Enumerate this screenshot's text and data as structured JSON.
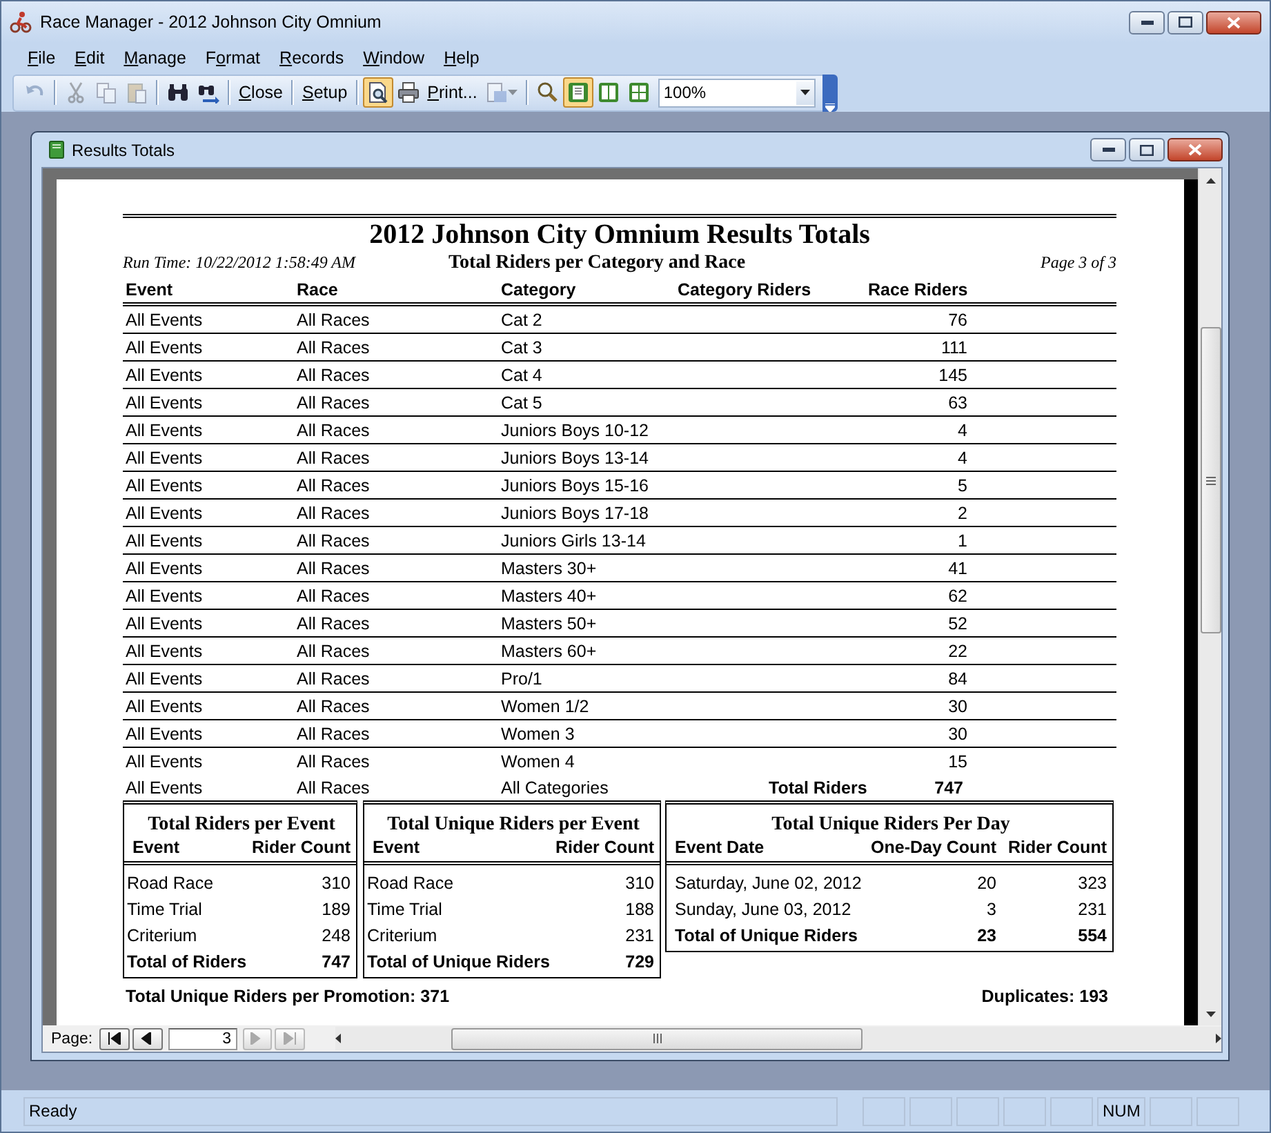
{
  "window": {
    "title": "Race Manager - 2012 Johnson City Omnium"
  },
  "menu": [
    {
      "label": "File"
    },
    {
      "label": "Edit"
    },
    {
      "label": "Manage"
    },
    {
      "label": "Format"
    },
    {
      "label": "Records"
    },
    {
      "label": "Window"
    },
    {
      "label": "Help"
    }
  ],
  "toolbar": [
    {
      "kind": "icon",
      "disabled": true,
      "selected": false
    },
    {
      "kind": "separator"
    },
    {
      "kind": "icon",
      "disabled": true,
      "selected": false
    },
    {
      "kind": "icon",
      "disabled": true,
      "selected": false
    },
    {
      "kind": "icon",
      "disabled": true,
      "selected": false
    },
    {
      "kind": "separator"
    },
    {
      "kind": "icon",
      "disabled": false,
      "selected": false
    },
    {
      "kind": "icon",
      "disabled": false,
      "selected": false
    },
    {
      "kind": "separator"
    },
    {
      "kind": "text",
      "label": "Close"
    },
    {
      "kind": "separator"
    },
    {
      "kind": "text",
      "label": "Setup"
    },
    {
      "kind": "separator"
    },
    {
      "kind": "icon",
      "disabled": false,
      "selected": true
    },
    {
      "kind": "icon",
      "disabled": false,
      "selected": false
    },
    {
      "kind": "text",
      "label": "Print..."
    },
    {
      "kind": "dropdown",
      "disabled": true
    },
    {
      "kind": "separator"
    },
    {
      "kind": "icon",
      "disabled": false,
      "selected": false
    },
    {
      "kind": "icon",
      "disabled": false,
      "selected": true
    },
    {
      "kind": "icon",
      "disabled": false,
      "selected": false
    },
    {
      "kind": "icon",
      "disabled": false,
      "selected": false
    },
    {
      "kind": "combo",
      "value": "100%"
    }
  ],
  "document": {
    "title": "Results Totals"
  },
  "report": {
    "title": "2012 Johnson City Omnium Results Totals",
    "run_time": "Run Time:  10/22/2012 1:58:49 AM",
    "subtitle": "Total Riders per Category and Race",
    "page": "Page 3 of 3",
    "columns": [
      "Event",
      "Race",
      "Category",
      "Category Riders",
      "Race Riders"
    ],
    "rows": [
      {
        "event": "All Events",
        "race": "All Races",
        "category": "Cat 2",
        "race_riders": "76"
      },
      {
        "event": "All Events",
        "race": "All Races",
        "category": "Cat 3",
        "race_riders": "111"
      },
      {
        "event": "All Events",
        "race": "All Races",
        "category": "Cat 4",
        "race_riders": "145"
      },
      {
        "event": "All Events",
        "race": "All Races",
        "category": "Cat 5",
        "race_riders": "63"
      },
      {
        "event": "All Events",
        "race": "All Races",
        "category": "Juniors Boys 10-12",
        "race_riders": "4"
      },
      {
        "event": "All Events",
        "race": "All Races",
        "category": "Juniors Boys 13-14",
        "race_riders": "4"
      },
      {
        "event": "All Events",
        "race": "All Races",
        "category": "Juniors Boys 15-16",
        "race_riders": "5"
      },
      {
        "event": "All Events",
        "race": "All Races",
        "category": "Juniors Boys 17-18",
        "race_riders": "2"
      },
      {
        "event": "All Events",
        "race": "All Races",
        "category": "Juniors Girls 13-14",
        "race_riders": "1"
      },
      {
        "event": "All Events",
        "race": "All Races",
        "category": "Masters 30+",
        "race_riders": "41"
      },
      {
        "event": "All Events",
        "race": "All Races",
        "category": "Masters 40+",
        "race_riders": "62"
      },
      {
        "event": "All Events",
        "race": "All Races",
        "category": "Masters 50+",
        "race_riders": "52"
      },
      {
        "event": "All Events",
        "race": "All Races",
        "category": "Masters 60+",
        "race_riders": "22"
      },
      {
        "event": "All Events",
        "race": "All Races",
        "category": "Pro/1",
        "race_riders": "84"
      },
      {
        "event": "All Events",
        "race": "All Races",
        "category": "Women 1/2",
        "race_riders": "30"
      },
      {
        "event": "All Events",
        "race": "All Races",
        "category": "Women 3",
        "race_riders": "30"
      },
      {
        "event": "All Events",
        "race": "All Races",
        "category": "Women 4",
        "race_riders": "15"
      }
    ],
    "total": {
      "event": "All Events",
      "race": "All Races",
      "category": "All Categories",
      "label": "Total Riders",
      "value": "747"
    },
    "summaries": [
      {
        "title": "Total Riders per Event",
        "columns": [
          "Event",
          "Rider Count"
        ],
        "rows": [
          [
            "Road Race",
            "310"
          ],
          [
            "Time Trial",
            "189"
          ],
          [
            "Criterium",
            "248"
          ]
        ],
        "total": [
          "Total of Riders",
          "747"
        ]
      },
      {
        "title": "Total Unique Riders per Event",
        "columns": [
          "Event",
          "Rider Count"
        ],
        "rows": [
          [
            "Road Race",
            "310"
          ],
          [
            "Time Trial",
            "188"
          ],
          [
            "Criterium",
            "231"
          ]
        ],
        "total": [
          "Total of Unique Riders",
          "729"
        ]
      },
      {
        "title": "Total Unique Riders Per Day",
        "columns": [
          "Event Date",
          "One-Day Count",
          "Rider Count"
        ],
        "rows": [
          [
            "Saturday, June 02, 2012",
            "20",
            "323"
          ],
          [
            "Sunday, June 03, 2012",
            "3",
            "231"
          ]
        ],
        "total": [
          "Total of Unique Riders",
          "23",
          "554"
        ]
      }
    ],
    "promotion": "Total Unique Riders per Promotion:  371",
    "duplicates": "Duplicates:  193"
  },
  "page_nav": {
    "label": "Page:",
    "value": "3",
    "buttons": [
      {
        "disabled": false
      },
      {
        "disabled": false
      },
      {
        "disabled": true
      },
      {
        "disabled": true
      }
    ]
  },
  "status_bar": {
    "text": "Ready",
    "indicators": [
      {
        "label": "NUM"
      }
    ]
  }
}
